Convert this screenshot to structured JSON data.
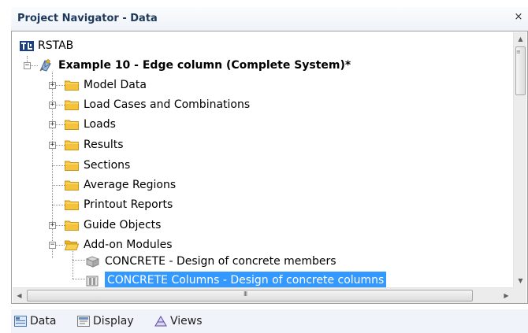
{
  "window": {
    "title": "Project Navigator - Data",
    "close_glyph": "×"
  },
  "tree": {
    "root": {
      "label": "RSTAB",
      "icon": "rstab-logo-icon"
    },
    "project": {
      "label": "Example 10 - Edge column (Complete System)*",
      "icon": "project-model-icon",
      "expanded": true
    },
    "items": [
      {
        "label": "Model Data",
        "expandable": true,
        "expanded": false
      },
      {
        "label": "Load Cases and Combinations",
        "expandable": true,
        "expanded": false
      },
      {
        "label": "Loads",
        "expandable": true,
        "expanded": false
      },
      {
        "label": "Results",
        "expandable": true,
        "expanded": false
      },
      {
        "label": "Sections",
        "expandable": false
      },
      {
        "label": "Average Regions",
        "expandable": false
      },
      {
        "label": "Printout Reports",
        "expandable": false
      },
      {
        "label": "Guide Objects",
        "expandable": true,
        "expanded": false
      },
      {
        "label": "Add-on Modules",
        "expandable": true,
        "expanded": true
      }
    ],
    "modules": [
      {
        "label": "CONCRETE - Design of concrete members",
        "icon": "concrete-module-icon",
        "selected": false
      },
      {
        "label": "CONCRETE Columns - Design of concrete columns",
        "icon": "concrete-columns-module-icon",
        "selected": true
      }
    ]
  },
  "tabs": [
    {
      "label": "Data",
      "icon": "data-tab-icon",
      "active": true
    },
    {
      "label": "Display",
      "icon": "display-tab-icon",
      "active": false
    },
    {
      "label": "Views",
      "icon": "views-tab-icon",
      "active": false
    }
  ],
  "colors": {
    "selection": "#3399ff",
    "title_text": "#1e395b",
    "folder": "#f5c33b"
  }
}
